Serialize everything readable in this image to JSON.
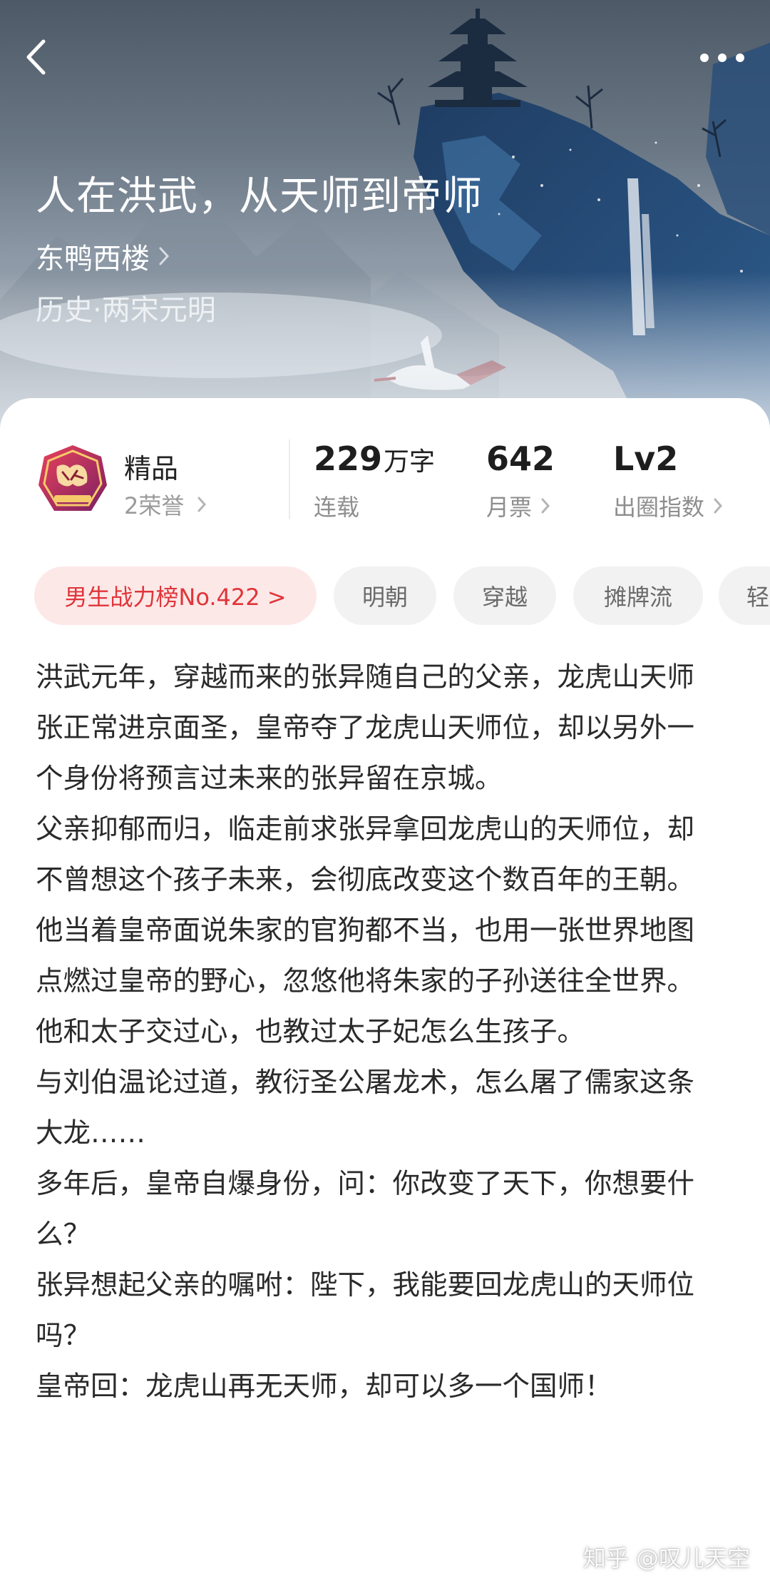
{
  "header": {
    "back_icon": "chevron-left-icon",
    "more_icon": "more-horizontal-icon"
  },
  "book": {
    "title": "人在洪武，从天师到帝师",
    "author": "东鸭西楼",
    "category": "历史·两宋元明"
  },
  "stats": {
    "quality_badge_icon": "boutique-badge-icon",
    "quality": "精品",
    "honors": "2荣誉",
    "word_count": "229",
    "word_unit": "万字",
    "status": "连载",
    "monthly_votes": "642",
    "monthly_votes_label": "月票",
    "circle_index": "Lv2",
    "circle_index_label": "出圈指数"
  },
  "tags": [
    "男生战力榜No.422 >",
    "明朝",
    "穿越",
    "摊牌流",
    "轻"
  ],
  "synopsis": [
    "洪武元年，穿越而来的张异随自己的父亲，龙虎山天师张正常进京面圣，皇帝夺了龙虎山天师位，却以另外一个身份将预言过未来的张异留在京城。",
    "父亲抑郁而归，临走前求张异拿回龙虎山的天师位，却不曾想这个孩子未来，会彻底改变这个数百年的王朝。",
    "他当着皇帝面说朱家的官狗都不当，也用一张世界地图点燃过皇帝的野心，忽悠他将朱家的子孙送往全世界。",
    "他和太子交过心，也教过太子妃怎么生孩子。",
    "与刘伯温论过道，教衍圣公屠龙术，怎么屠了儒家这条大龙……",
    "多年后，皇帝自爆身份，问：你改变了天下，你想要什么？",
    "张异想起父亲的嘱咐：陛下，我能要回龙虎山的天师位吗？",
    "皇帝回：龙虎山再无天师，却可以多一个国师！"
  ],
  "watermark": "知乎 @叹儿天空"
}
